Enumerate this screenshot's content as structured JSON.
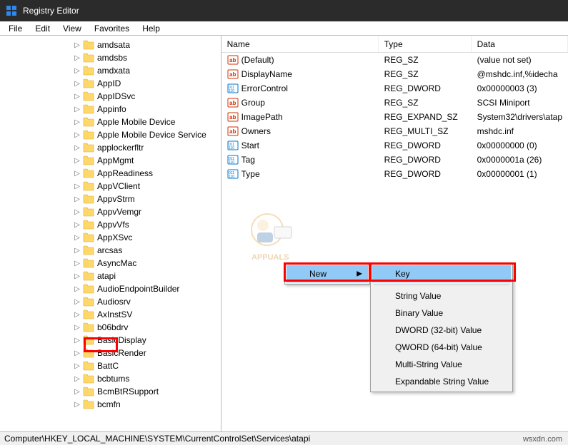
{
  "window": {
    "title": "Registry Editor"
  },
  "menu": {
    "items": [
      "File",
      "Edit",
      "View",
      "Favorites",
      "Help"
    ]
  },
  "tree": {
    "indent": 102,
    "items": [
      {
        "label": "amdsata"
      },
      {
        "label": "amdsbs"
      },
      {
        "label": "amdxata"
      },
      {
        "label": "AppID"
      },
      {
        "label": "AppIDSvc"
      },
      {
        "label": "Appinfo"
      },
      {
        "label": "Apple Mobile Device"
      },
      {
        "label": "Apple Mobile Device Service"
      },
      {
        "label": "applockerfltr"
      },
      {
        "label": "AppMgmt"
      },
      {
        "label": "AppReadiness"
      },
      {
        "label": "AppVClient"
      },
      {
        "label": "AppvStrm"
      },
      {
        "label": "AppvVemgr"
      },
      {
        "label": "AppvVfs"
      },
      {
        "label": "AppXSvc"
      },
      {
        "label": "arcsas"
      },
      {
        "label": "AsyncMac"
      },
      {
        "label": "atapi",
        "selected": true
      },
      {
        "label": "AudioEndpointBuilder"
      },
      {
        "label": "Audiosrv"
      },
      {
        "label": "AxInstSV"
      },
      {
        "label": "b06bdrv"
      },
      {
        "label": "BasicDisplay"
      },
      {
        "label": "BasicRender"
      },
      {
        "label": "BattC"
      },
      {
        "label": "bcbtums"
      },
      {
        "label": "BcmBtRSupport"
      },
      {
        "label": "bcmfn"
      }
    ]
  },
  "columns": {
    "name": "Name",
    "type": "Type",
    "data": "Data"
  },
  "values": [
    {
      "icon": "sz",
      "name": "(Default)",
      "type": "REG_SZ",
      "data": "(value not set)"
    },
    {
      "icon": "sz",
      "name": "DisplayName",
      "type": "REG_SZ",
      "data": "@mshdc.inf,%idecha"
    },
    {
      "icon": "dw",
      "name": "ErrorControl",
      "type": "REG_DWORD",
      "data": "0x00000003 (3)"
    },
    {
      "icon": "sz",
      "name": "Group",
      "type": "REG_SZ",
      "data": "SCSI Miniport"
    },
    {
      "icon": "sz",
      "name": "ImagePath",
      "type": "REG_EXPAND_SZ",
      "data": "System32\\drivers\\atap"
    },
    {
      "icon": "sz",
      "name": "Owners",
      "type": "REG_MULTI_SZ",
      "data": "mshdc.inf"
    },
    {
      "icon": "dw",
      "name": "Start",
      "type": "REG_DWORD",
      "data": "0x00000000 (0)"
    },
    {
      "icon": "dw",
      "name": "Tag",
      "type": "REG_DWORD",
      "data": "0x0000001a (26)"
    },
    {
      "icon": "dw",
      "name": "Type",
      "type": "REG_DWORD",
      "data": "0x00000001 (1)"
    }
  ],
  "context1": {
    "items": [
      {
        "label": "New",
        "arrow": true,
        "highlight": true
      }
    ]
  },
  "context2": {
    "items": [
      {
        "label": "Key",
        "highlight": true
      },
      {
        "label": "String Value"
      },
      {
        "label": "Binary Value"
      },
      {
        "label": "DWORD (32-bit) Value"
      },
      {
        "label": "QWORD (64-bit) Value"
      },
      {
        "label": "Multi-String Value"
      },
      {
        "label": "Expandable String Value"
      }
    ]
  },
  "status": {
    "path": "Computer\\HKEY_LOCAL_MACHINE\\SYSTEM\\CurrentControlSet\\Services\\atapi"
  },
  "watermark_text": "APPUALS",
  "domain_text": "wsxdn.com"
}
